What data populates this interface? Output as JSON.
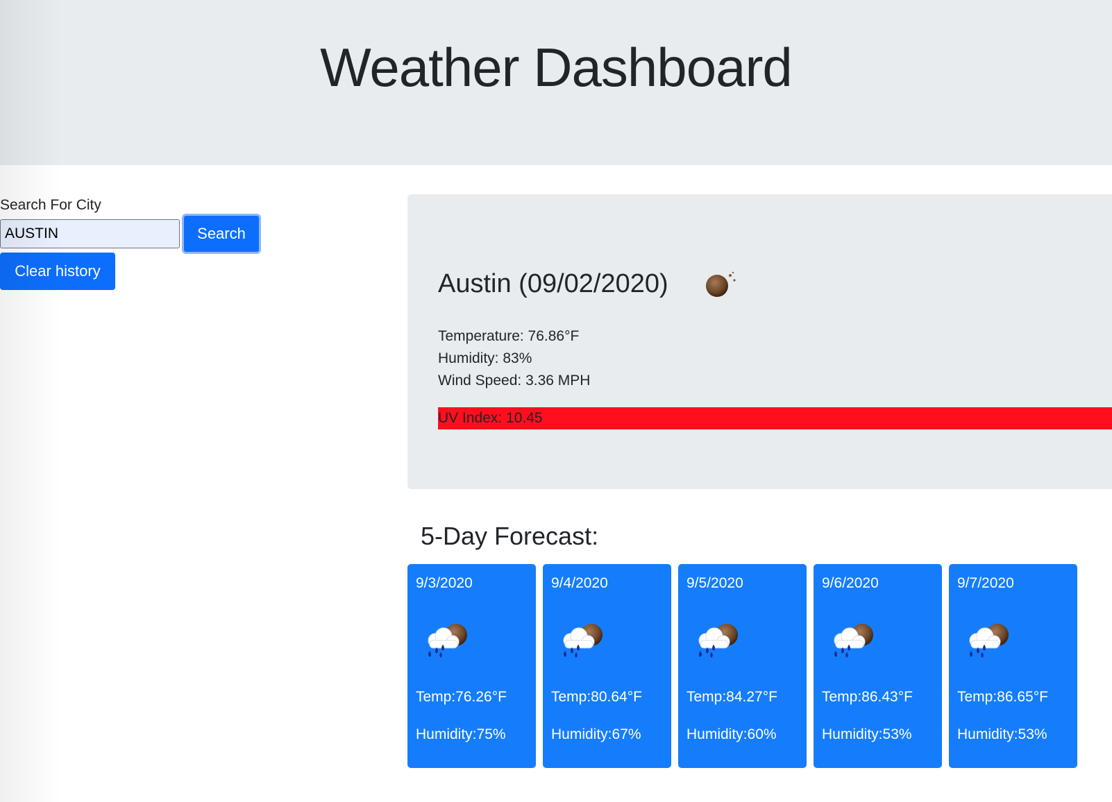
{
  "header": {
    "title": "Weather Dashboard"
  },
  "search": {
    "label": "Search For City",
    "value": "AUSTIN",
    "button_label": "Search",
    "clear_label": "Clear history"
  },
  "current": {
    "title": "Austin (09/02/2020)",
    "icon": "moon-night-icon",
    "temperature": "Temperature: 76.86°F",
    "humidity": "Humidity: 83%",
    "wind": "Wind Speed: 3.36 MPH",
    "uv": "UV Index: 10.45",
    "uv_color": "#ff0f1e"
  },
  "forecast": {
    "title": "5-Day Forecast:",
    "card_color": "#157dfb",
    "days": [
      {
        "date": "9/3/2020",
        "temp": "Temp:76.26°F",
        "humidity": "Humidity:75%",
        "icon": "rain-cloud-night-icon"
      },
      {
        "date": "9/4/2020",
        "temp": "Temp:80.64°F",
        "humidity": "Humidity:67%",
        "icon": "rain-cloud-night-icon"
      },
      {
        "date": "9/5/2020",
        "temp": "Temp:84.27°F",
        "humidity": "Humidity:60%",
        "icon": "rain-cloud-night-icon"
      },
      {
        "date": "9/6/2020",
        "temp": "Temp:86.43°F",
        "humidity": "Humidity:53%",
        "icon": "rain-cloud-night-icon"
      },
      {
        "date": "9/7/2020",
        "temp": "Temp:86.65°F",
        "humidity": "Humidity:53%",
        "icon": "rain-cloud-night-icon"
      }
    ]
  }
}
